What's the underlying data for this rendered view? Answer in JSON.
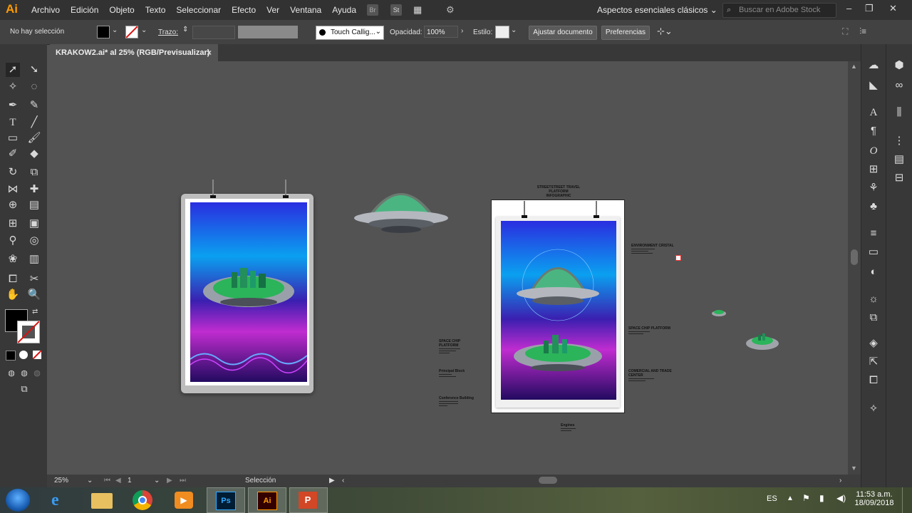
{
  "app": {
    "logo": "Ai"
  },
  "menu": [
    "Archivo",
    "Edición",
    "Objeto",
    "Texto",
    "Seleccionar",
    "Efecto",
    "Ver",
    "Ventana",
    "Ayuda"
  ],
  "workspace": {
    "label": "Aspectos esenciales clásicos",
    "search_placeholder": "Buscar en Adobe Stock"
  },
  "menu_icons": {
    "bridge": "Br",
    "stock": "St"
  },
  "control": {
    "selection": "No hay selección",
    "stroke_label": "Trazo:",
    "brush": "Touch Callig...",
    "opacity_label": "Opacidad:",
    "opacity_value": "100%",
    "style_label": "Estilo:",
    "doc_setup": "Ajustar documento",
    "prefs": "Preferencias"
  },
  "document": {
    "tab_title": "KRAKOW2.ai* al 25% (RGB/Previsualizar)",
    "close": "×"
  },
  "artboard": {
    "heading_line1": "STREETSTREET TRAVEL PLATFORM",
    "heading_line2": "INFOGRAPHIC",
    "labels": {
      "environment": "ENVIRONMENT CRISTAL",
      "platform_right": "SPACE CHIP PLATFORM",
      "commercial": "COMERCIAL AND TRADE CENTER",
      "platform_left": "SPACE CHIP PLATFORM",
      "principal": "Principal Block",
      "conference": "Conference Building",
      "engines": "Engines"
    }
  },
  "status": {
    "zoom": "25%",
    "page": "1",
    "tool": "Selección"
  },
  "taskbar": {
    "lang": "ES",
    "time": "11:53 a.m.",
    "date": "18/09/2018"
  },
  "colors": {
    "accent_ai": "#ff9a00",
    "canvas": "#535353",
    "panel": "#383838"
  }
}
